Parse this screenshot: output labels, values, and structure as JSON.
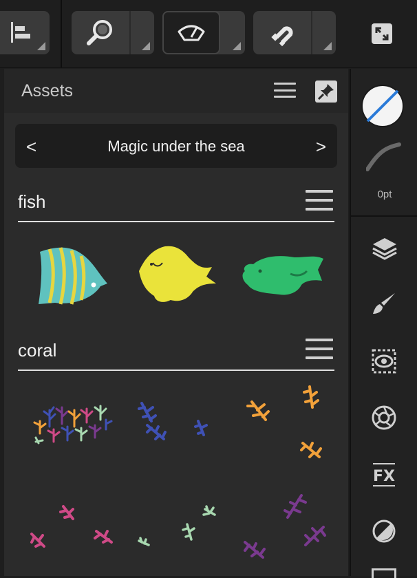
{
  "toolbar": {
    "buttons": [
      {
        "name": "align",
        "icon": "align-left-icon"
      },
      {
        "name": "zoom",
        "icon": "magnifier-icon"
      },
      {
        "name": "view-mode",
        "icon": "view-quality-icon",
        "active": true
      },
      {
        "name": "snapping",
        "icon": "magnet-icon"
      },
      {
        "name": "fullscreen",
        "icon": "expand-icon"
      }
    ]
  },
  "panel": {
    "title": "Assets",
    "collection": "Magic under the sea",
    "prev_glyph": "<",
    "next_glyph": ">",
    "categories": [
      {
        "name": "fish",
        "assets": [
          "angelfish",
          "yellow-tang",
          "green-grouper"
        ]
      },
      {
        "name": "coral",
        "assets": [
          "coral-cluster-multicolor",
          "coral-blue",
          "coral-orange",
          "coral-pink",
          "coral-green",
          "coral-purple"
        ]
      }
    ]
  },
  "right_column": {
    "stroke_width_label": "0pt",
    "tools": [
      "layers-icon",
      "brush-icon",
      "adjustments-icon",
      "effects-ring-icon",
      "fx-icon",
      "blend-icon"
    ]
  },
  "colors": {
    "fish_teal": "#5fc2bf",
    "fish_yellow": "#eae33a",
    "fish_green": "#2fbd6d",
    "coral_blue": "#3f51b5",
    "coral_orange": "#f2a13a",
    "coral_pink": "#cf4a87",
    "coral_mint": "#a8d8b0",
    "coral_purple": "#7a3a8f",
    "accent_blue": "#2a7ad8"
  }
}
